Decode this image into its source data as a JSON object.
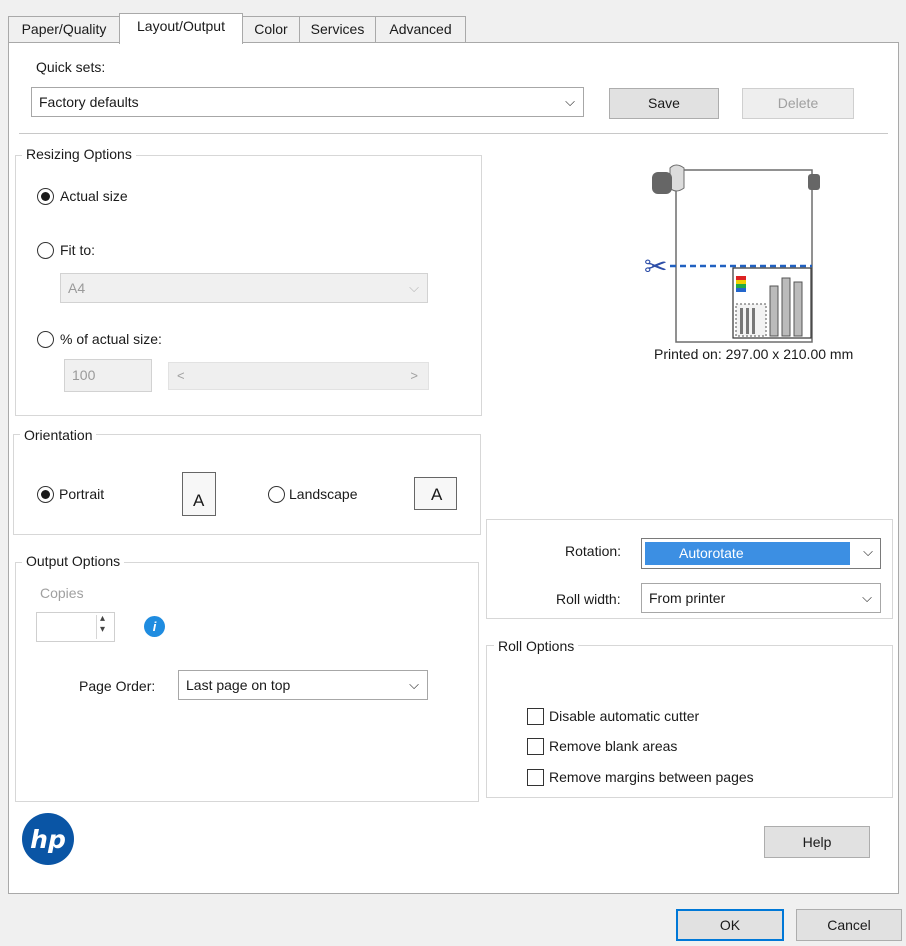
{
  "tabs": [
    {
      "label": "Paper/Quality"
    },
    {
      "label": "Layout/Output"
    },
    {
      "label": "Color"
    },
    {
      "label": "Services"
    },
    {
      "label": "Advanced"
    }
  ],
  "quick_sets": {
    "label": "Quick sets:",
    "value": "Factory defaults",
    "save_label": "Save",
    "delete_label": "Delete"
  },
  "resizing": {
    "title": "Resizing Options",
    "actual_size": "Actual size",
    "fit_to": "Fit to:",
    "fit_to_value": "A4",
    "percent_label": "% of actual size:",
    "percent_value": "100",
    "scroll_left": "<",
    "scroll_right": ">"
  },
  "preview": {
    "printed_on": "Printed on: 297.00 x 210.00 mm"
  },
  "orientation": {
    "title": "Orientation",
    "portrait": "Portrait",
    "landscape": "Landscape",
    "glyph": "A"
  },
  "rotation": {
    "label": "Rotation:",
    "value": "Autorotate",
    "roll_width_label": "Roll width:",
    "roll_width_value": "From printer"
  },
  "output": {
    "title": "Output Options",
    "copies_label": "Copies",
    "page_order_label": "Page Order:",
    "page_order_value": "Last page on top"
  },
  "roll_options": {
    "title": "Roll Options",
    "disable_cutter": "Disable automatic cutter",
    "remove_blank": "Remove blank areas",
    "remove_margins": "Remove margins between pages"
  },
  "footer": {
    "help_label": "Help",
    "ok_label": "OK",
    "cancel_label": "Cancel"
  },
  "colors": {
    "selection_blue": "#3c8fe3",
    "info_blue": "#1f8ce0",
    "hp_blue": "#0a55a5"
  }
}
